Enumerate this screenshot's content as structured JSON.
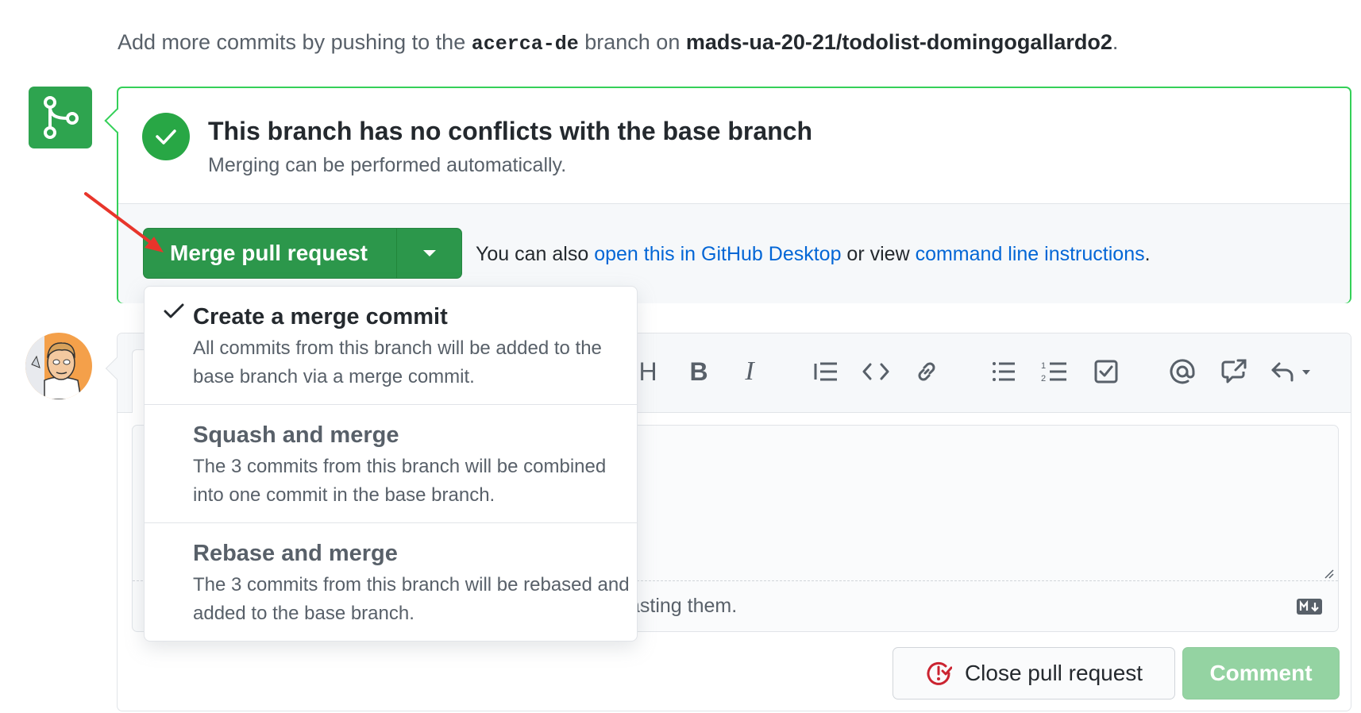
{
  "top": {
    "prefix": "Add more commits by pushing to the ",
    "branch": "acerca-de",
    "middle": " branch on ",
    "repo": "mads-ua-20-21/todolist-domingogallardo2",
    "suffix": "."
  },
  "merge_box": {
    "title": "This branch has no conflicts with the base branch",
    "subtitle": "Merging can be performed automatically.",
    "merge_button_label": "Merge pull request",
    "also_text": "You can also ",
    "desktop_link": "open this in GitHub Desktop",
    "or_view": " or view ",
    "cli_link": "command line instructions",
    "period": "."
  },
  "dropdown": {
    "items": [
      {
        "title": "Create a merge commit",
        "description": "All commits from this branch will be added to the base branch via a merge commit.",
        "selected": true
      },
      {
        "title": "Squash and merge",
        "description": "The 3 commits from this branch will be combined into one commit in the base branch.",
        "selected": false
      },
      {
        "title": "Rebase and merge",
        "description": "The 3 commits from this branch will be rebased and added to the base branch.",
        "selected": false
      }
    ]
  },
  "comment": {
    "toolbar": {
      "heading": "H",
      "bold": "B",
      "italic": "I"
    },
    "attach_text_visible": "asting them.",
    "close_button_label": "Close pull request",
    "comment_button_label": "Comment"
  },
  "colors": {
    "success": "#2ea44f",
    "link": "#0366d6",
    "border_success": "#34d058",
    "annotation_arrow": "#e8352b",
    "close_icon": "#cb2431"
  }
}
